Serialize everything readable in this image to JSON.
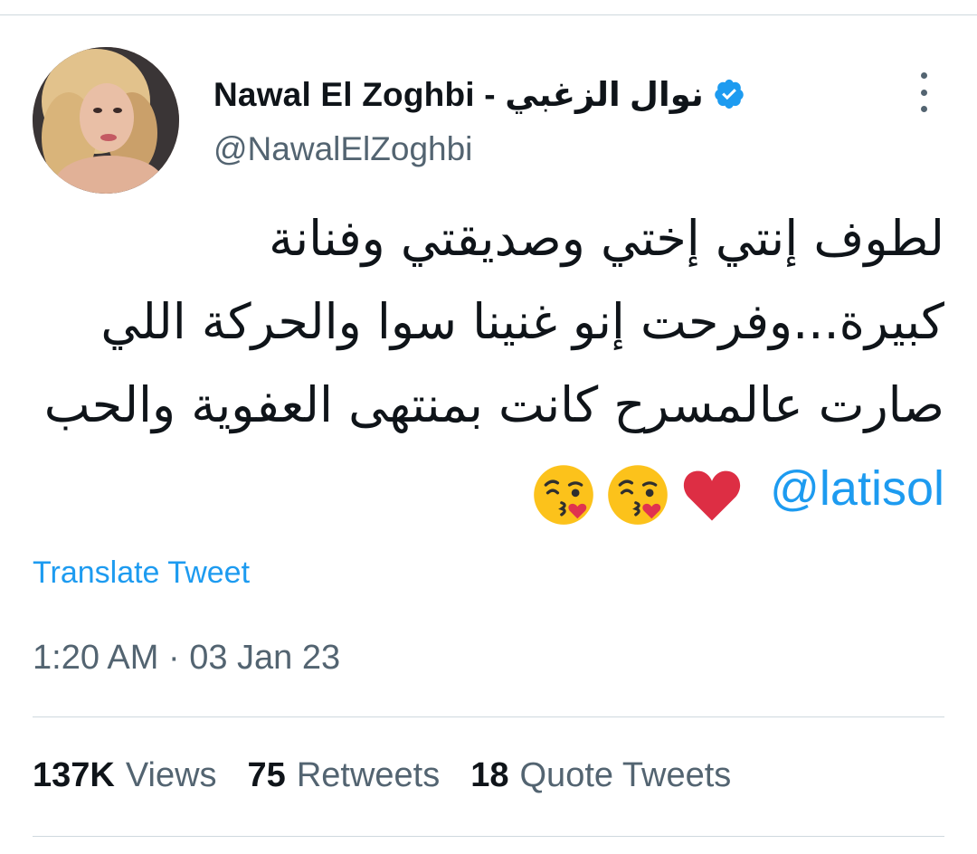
{
  "author": {
    "display_name": "Nawal El Zoghbi - نوال الزغبي",
    "handle": "@NawalElZoghbi",
    "verified": true,
    "avatar_icon": "profile-photo"
  },
  "tweet": {
    "text_arabic": "لطوف إنتي إختي وصديقتي وفنانة كبيرة...وفرحت إنو غنينا سوا والحركة اللي صارت عالمسرح كانت بمنتهى العفوية والحب",
    "mention": "@latisol",
    "emojis": [
      "kissing-face-with-heart",
      "kissing-face-with-heart",
      "red-heart"
    ]
  },
  "translate_label": "Translate Tweet",
  "timestamp": "1:20 AM · 03 Jan 23",
  "stats": [
    {
      "value": "137K",
      "label": "Views"
    },
    {
      "value": "75",
      "label": "Retweets"
    },
    {
      "value": "18",
      "label": "Quote Tweets"
    }
  ],
  "colors": {
    "link": "#1d9bf0",
    "secondary_text": "#536471",
    "primary_text": "#0f1419",
    "divider": "#cfd9de"
  }
}
